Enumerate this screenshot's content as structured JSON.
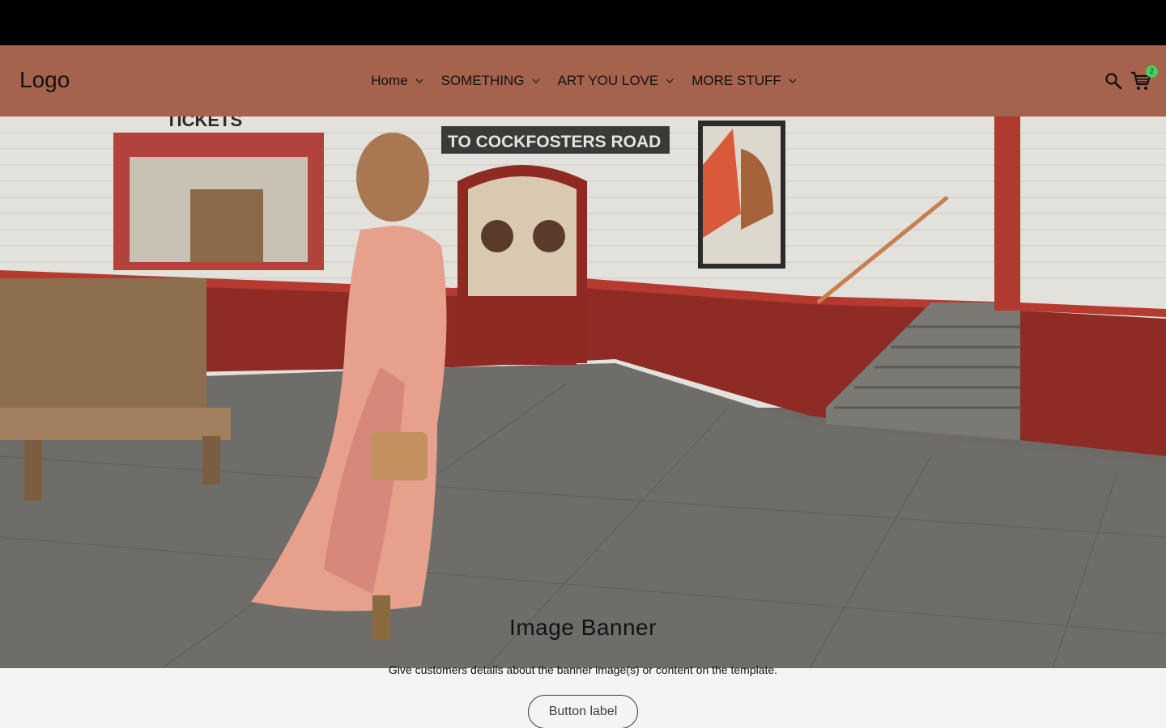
{
  "header": {
    "logo": "Logo",
    "nav": [
      {
        "label": "Home"
      },
      {
        "label": "SOMETHING"
      },
      {
        "label": "ART YOU LOVE"
      },
      {
        "label": "MORE STUFF"
      }
    ],
    "search_icon": "search-icon",
    "cart_icon": "cart-icon",
    "cart_count": "2"
  },
  "banner": {
    "sign_tickets": "TICKETS",
    "sign_direction": "TO COCKFOSTERS ROAD",
    "heading": "Image Banner",
    "text": "Give customers details about the banner image(s) or content on the template.",
    "button_label": "Button label"
  },
  "colors": {
    "header_bg": "#a5624c",
    "announcement_bg": "#000000",
    "page_bg": "#f4f4f4",
    "cart_badge": "#46d05f"
  }
}
